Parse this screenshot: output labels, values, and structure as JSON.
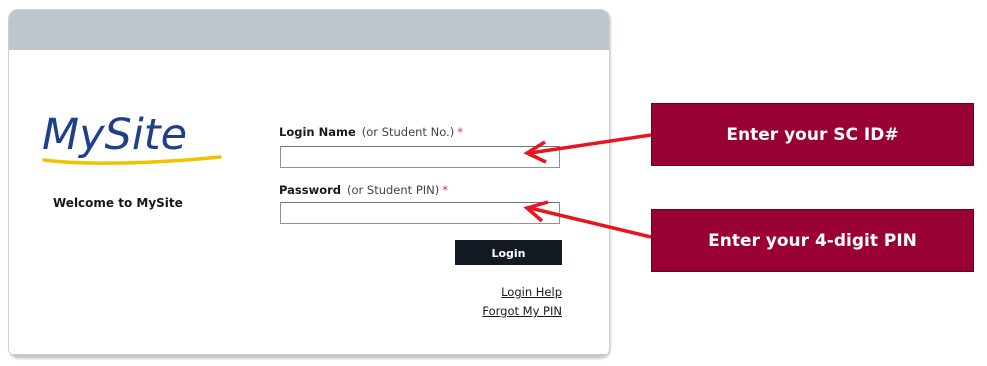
{
  "logo": {
    "text": "MySite"
  },
  "welcome_text": "Welcome to MySite",
  "form": {
    "login_label": "Login Name",
    "login_hint": "(or Student No.)",
    "password_label": "Password",
    "password_hint": "(or Student PIN)",
    "required_mark": "*",
    "login_value": "",
    "password_value": "",
    "login_button": "Login",
    "help_link": "Login Help",
    "forgot_link": "Forgot My PIN"
  },
  "callouts": {
    "id_text": "Enter your SC ID#",
    "pin_text": "Enter your 4-digit PIN"
  },
  "colors": {
    "callout_bg": "#990033",
    "arrow": "#e8141e",
    "header_bar": "#bcc6cc",
    "logo_blue": "#1f3f8c",
    "logo_swoosh": "#f2c200",
    "button_bg": "#141a24"
  }
}
